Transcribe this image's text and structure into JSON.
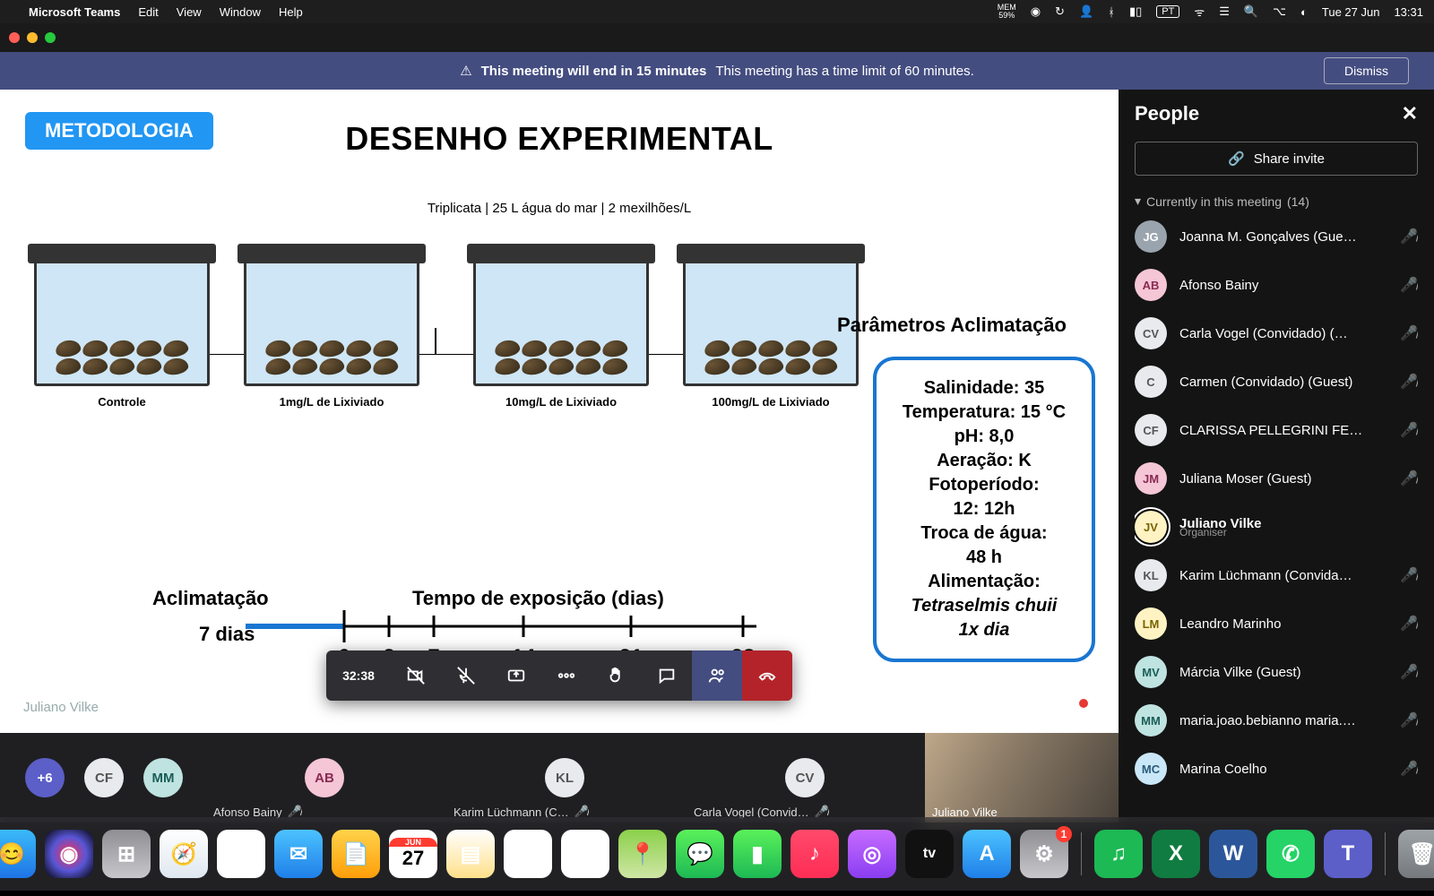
{
  "menubar": {
    "app": "Microsoft Teams",
    "items": [
      "Edit",
      "View",
      "Window",
      "Help"
    ],
    "mem": "MEM\n59%",
    "lang": "PT",
    "date": "Tue 27 Jun",
    "time": "13:31"
  },
  "banner": {
    "icon": "warning-icon",
    "bold": "This meeting will end in 15 minutes",
    "rest": "This meeting has a time limit of 60 minutes.",
    "dismiss": "Dismiss"
  },
  "slide": {
    "tag": "METODOLOGIA",
    "title": "DESENHO EXPERIMENTAL",
    "triplicate": "Triplicata | 25 L água do mar | 2 mexilhões/L",
    "tanks": [
      {
        "label": "Controle"
      },
      {
        "label": "1mg/L de Lixiviado"
      },
      {
        "label": "10mg/L de Lixiviado"
      },
      {
        "label": "100mg/L de Lixiviado"
      }
    ],
    "acl_label": "Aclimatação",
    "acl_days": "7 dias",
    "expo_title": "Tempo de exposição (dias)",
    "ticks": [
      "0",
      "3",
      "7",
      "14",
      "21",
      "28"
    ],
    "param_title": "Parâmetros Aclimatação",
    "params": [
      "Salinidade: 35",
      "Temperatura: 15 °C",
      "pH: 8,0",
      "Aeração: K",
      "Fotoperíodo:",
      "12: 12h",
      "Troca de água:",
      "48 h",
      "Alimentação:"
    ],
    "params_italic": [
      "Tetraselmis chuii",
      "1x dia"
    ],
    "presenter": "Juliano Vilke"
  },
  "toolbar": {
    "timer": "32:38"
  },
  "strip": {
    "plus": "+6",
    "small": [
      {
        "initials": "CF",
        "bg": "#e8eaed",
        "fg": "#555"
      },
      {
        "initials": "MM",
        "bg": "#bfe3e0",
        "fg": "#1a5d58"
      }
    ],
    "tiles": [
      {
        "initials": "AB",
        "bg": "#f4c6d6",
        "fg": "#8a2a52",
        "name": "Afonso Bainy"
      },
      {
        "initials": "KL",
        "bg": "#e8eaed",
        "fg": "#555",
        "name": "Karim Lüchmann (C…"
      },
      {
        "initials": "CV",
        "bg": "#e8eaed",
        "fg": "#555",
        "name": "Carla Vogel (Convid…"
      }
    ],
    "camera_name": "Juliano Vilke"
  },
  "panel": {
    "title": "People",
    "share": "Share invite",
    "section": "Currently in this meeting",
    "count": "(14)",
    "people": [
      {
        "initials": "JG",
        "bg": "#9aa4ae",
        "fg": "#fff",
        "name": "Joanna M. Gonçalves (Gue…",
        "muted": true
      },
      {
        "initials": "AB",
        "bg": "#f4c6d6",
        "fg": "#8a2a52",
        "name": "Afonso Bainy",
        "muted": true
      },
      {
        "initials": "CV",
        "bg": "#e8eaed",
        "fg": "#555",
        "name": "Carla Vogel (Convidado) (…",
        "muted": true
      },
      {
        "initials": "C",
        "bg": "#e8eaed",
        "fg": "#555",
        "name": "Carmen (Convidado) (Guest)",
        "muted": true
      },
      {
        "initials": "CF",
        "bg": "#e8eaed",
        "fg": "#555",
        "name": "CLARISSA PELLEGRINI FE…",
        "muted": true
      },
      {
        "initials": "JM",
        "bg": "#f4c6d6",
        "fg": "#8a2a52",
        "name": "Juliana Moser (Guest)",
        "muted": true
      },
      {
        "initials": "JV",
        "bg": "#fff3c4",
        "fg": "#7a6400",
        "name": "Juliano Vilke",
        "sub": "Organiser",
        "muted": false,
        "ring": true
      },
      {
        "initials": "KL",
        "bg": "#e8eaed",
        "fg": "#555",
        "name": "Karim Lüchmann (Convida…",
        "muted": true
      },
      {
        "initials": "LM",
        "bg": "#fff3c4",
        "fg": "#7a6400",
        "name": "Leandro Marinho",
        "muted": true
      },
      {
        "initials": "MV",
        "bg": "#bfe3e0",
        "fg": "#1a5d58",
        "name": "Márcia Vilke (Guest)",
        "muted": true
      },
      {
        "initials": "MM",
        "bg": "#bfe3e0",
        "fg": "#1a5d58",
        "name": "maria.joao.bebianno maria.…",
        "muted": true
      },
      {
        "initials": "MC",
        "bg": "#c9e7f7",
        "fg": "#2a5a7a",
        "name": "Marina Coelho",
        "muted": true
      }
    ]
  },
  "dock": {
    "apps": [
      {
        "name": "finder",
        "bg": "linear-gradient(#3bbaf9,#1e74e6)",
        "glyph": "😊"
      },
      {
        "name": "siri",
        "bg": "radial-gradient(circle,#ff2d55,#5856d6,#000)",
        "glyph": "◉"
      },
      {
        "name": "launchpad",
        "bg": "linear-gradient(#8e8e93,#c7c7cc)",
        "glyph": "⊞"
      },
      {
        "name": "safari",
        "bg": "linear-gradient(#fff,#dfe7ef)",
        "glyph": "🧭"
      },
      {
        "name": "photos",
        "bg": "#fff",
        "glyph": "✿"
      },
      {
        "name": "mail",
        "bg": "linear-gradient(#4cc2ff,#1f7fe8)",
        "glyph": "✉"
      },
      {
        "name": "notes-alt",
        "bg": "linear-gradient(#ffd24a,#ff9f0a)",
        "glyph": "📄"
      },
      {
        "name": "calendar",
        "bg": "#fff",
        "glyph": "27",
        "text": "JUN",
        "badge": null
      },
      {
        "name": "notes",
        "bg": "linear-gradient(#fff,#ffe08a)",
        "glyph": "▤"
      },
      {
        "name": "freeform",
        "bg": "#fff",
        "glyph": "〰"
      },
      {
        "name": "reminders",
        "bg": "#fff",
        "glyph": "▥"
      },
      {
        "name": "maps",
        "bg": "linear-gradient(#8bd04a,#cfe6a5)",
        "glyph": "📍"
      },
      {
        "name": "messages",
        "bg": "linear-gradient(#5af15a,#1db954)",
        "glyph": "💬"
      },
      {
        "name": "facetime",
        "bg": "linear-gradient(#5af15a,#1db954)",
        "glyph": "▮"
      },
      {
        "name": "music",
        "bg": "linear-gradient(#ff4a6b,#ff2d55)",
        "glyph": "♪"
      },
      {
        "name": "podcasts",
        "bg": "linear-gradient(#c66cff,#8a3ef2)",
        "glyph": "◎"
      },
      {
        "name": "tv",
        "bg": "#111",
        "glyph": "tv"
      },
      {
        "name": "appstore",
        "bg": "linear-gradient(#4cc2ff,#1f7fe8)",
        "glyph": "A"
      },
      {
        "name": "settings",
        "bg": "linear-gradient(#8e8e93,#c7c7cc)",
        "glyph": "⚙",
        "badge": "1"
      },
      {
        "name": "sep"
      },
      {
        "name": "spotify",
        "bg": "#1db954",
        "glyph": "♫"
      },
      {
        "name": "excel",
        "bg": "#107c41",
        "glyph": "X"
      },
      {
        "name": "word",
        "bg": "#2b579a",
        "glyph": "W"
      },
      {
        "name": "whatsapp",
        "bg": "#25d366",
        "glyph": "✆"
      },
      {
        "name": "teams",
        "bg": "#5b5fc7",
        "glyph": "T"
      },
      {
        "name": "sep"
      },
      {
        "name": "trash",
        "bg": "",
        "glyph": "🗑"
      }
    ]
  }
}
